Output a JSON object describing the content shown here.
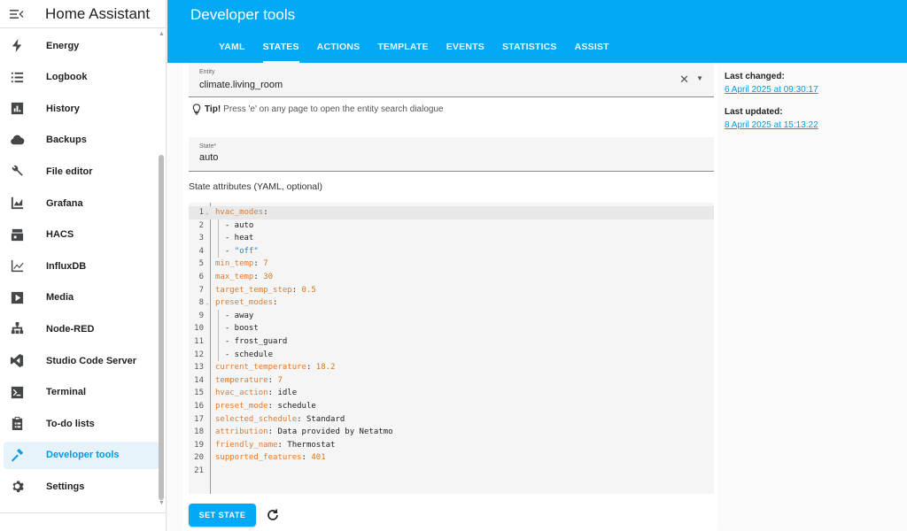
{
  "app": {
    "title": "Home Assistant"
  },
  "sidebar": {
    "items": [
      {
        "label": "Energy",
        "icon": "lightning-icon"
      },
      {
        "label": "Logbook",
        "icon": "list-icon"
      },
      {
        "label": "History",
        "icon": "chart-box-icon"
      },
      {
        "label": "Backups",
        "icon": "cloud-icon"
      },
      {
        "label": "File editor",
        "icon": "wrench-icon"
      },
      {
        "label": "Grafana",
        "icon": "chart-areaspline-icon"
      },
      {
        "label": "HACS",
        "icon": "hacs-icon"
      },
      {
        "label": "InfluxDB",
        "icon": "chart-line-icon"
      },
      {
        "label": "Media",
        "icon": "play-box-icon"
      },
      {
        "label": "Node-RED",
        "icon": "sitemap-icon"
      },
      {
        "label": "Studio Code Server",
        "icon": "vscode-icon"
      },
      {
        "label": "Terminal",
        "icon": "console-icon"
      },
      {
        "label": "To-do lists",
        "icon": "clipboard-list-icon"
      },
      {
        "label": "Developer tools",
        "icon": "hammer-icon"
      },
      {
        "label": "Settings",
        "icon": "cog-icon"
      }
    ],
    "active": "Developer tools"
  },
  "header": {
    "title": "Developer tools",
    "tabs": [
      "YAML",
      "STATES",
      "ACTIONS",
      "TEMPLATE",
      "EVENTS",
      "STATISTICS",
      "ASSIST"
    ],
    "active_tab": "STATES"
  },
  "entity": {
    "label": "Entity",
    "value": "climate.living_room"
  },
  "tip": {
    "bold": "Tip!",
    "text": "Press 'e' on any page to open the entity search dialogue"
  },
  "state": {
    "label": "State*",
    "value": "auto"
  },
  "attributes": {
    "label": "State attributes (YAML, optional)",
    "lines": [
      [
        [
          "k",
          "hvac_modes"
        ],
        [
          "p",
          ":"
        ]
      ],
      [
        [
          "p",
          "  - auto"
        ]
      ],
      [
        [
          "p",
          "  - heat"
        ]
      ],
      [
        [
          "p",
          "  - "
        ],
        [
          "s",
          "\"off\""
        ]
      ],
      [
        [
          "k",
          "min_temp"
        ],
        [
          "p",
          ": "
        ],
        [
          "n",
          "7"
        ]
      ],
      [
        [
          "k",
          "max_temp"
        ],
        [
          "p",
          ": "
        ],
        [
          "n",
          "30"
        ]
      ],
      [
        [
          "k",
          "target_temp_step"
        ],
        [
          "p",
          ": "
        ],
        [
          "n",
          "0.5"
        ]
      ],
      [
        [
          "k",
          "preset_modes"
        ],
        [
          "p",
          ":"
        ]
      ],
      [
        [
          "p",
          "  - away"
        ]
      ],
      [
        [
          "p",
          "  - boost"
        ]
      ],
      [
        [
          "p",
          "  - frost_guard"
        ]
      ],
      [
        [
          "p",
          "  - schedule"
        ]
      ],
      [
        [
          "k",
          "current_temperature"
        ],
        [
          "p",
          ": "
        ],
        [
          "n",
          "18.2"
        ]
      ],
      [
        [
          "k",
          "temperature"
        ],
        [
          "p",
          ": "
        ],
        [
          "n",
          "7"
        ]
      ],
      [
        [
          "k",
          "hvac_action"
        ],
        [
          "p",
          ": idle"
        ]
      ],
      [
        [
          "k",
          "preset_mode"
        ],
        [
          "p",
          ": schedule"
        ]
      ],
      [
        [
          "k",
          "selected_schedule"
        ],
        [
          "p",
          ": Standard"
        ]
      ],
      [
        [
          "k",
          "attribution"
        ],
        [
          "p",
          ": Data provided by Netatmo"
        ]
      ],
      [
        [
          "k",
          "friendly_name"
        ],
        [
          "p",
          ": Thermostat"
        ]
      ],
      [
        [
          "k",
          "supported_features"
        ],
        [
          "p",
          ": "
        ],
        [
          "n",
          "401"
        ]
      ],
      []
    ]
  },
  "buttons": {
    "set_state": "SET STATE"
  },
  "meta": {
    "last_changed_label": "Last changed:",
    "last_changed": "6 April 2025 at 09:30:17",
    "last_updated_label": "Last updated:",
    "last_updated": "8 April 2025 at 15:13:22"
  },
  "colors": {
    "accent": "#03a9f4",
    "yaml_key": "#e07b2e",
    "yaml_string": "#1f7fbf"
  }
}
